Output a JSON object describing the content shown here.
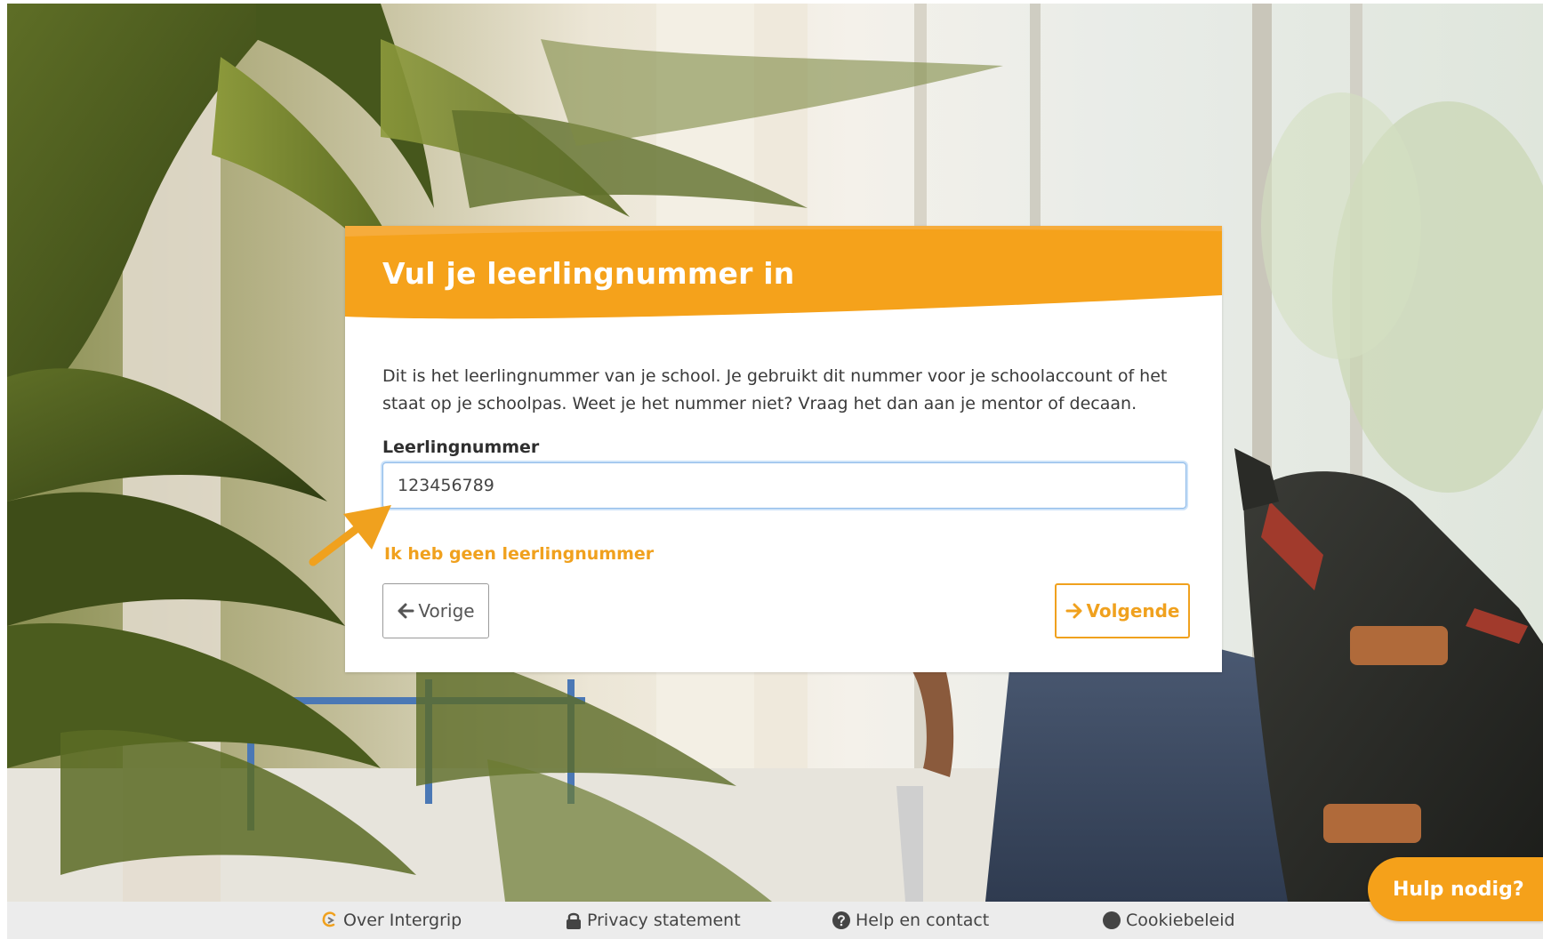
{
  "card": {
    "title": "Vul je leerlingnummer in",
    "description": "Dit is het leerlingnummer van je school. Je gebruikt dit nummer voor je schoolaccount of het staat op je schoolpas. Weet je het nummer niet? Vraag het dan aan je mentor of decaan.",
    "field_label": "Leerlingnummer",
    "field_value": "123456789",
    "no_number_link": "Ik heb geen leerlingnummer",
    "prev_button": "Vorige",
    "next_button": "Volgende"
  },
  "footer": {
    "items": [
      {
        "label": "Over Intergrip",
        "icon": "intergrip-logo-icon"
      },
      {
        "label": "Privacy statement",
        "icon": "lock-icon"
      },
      {
        "label": "Help en contact",
        "icon": "question-circle-icon"
      },
      {
        "label": "Cookiebeleid",
        "icon": "circle-icon"
      }
    ]
  },
  "help": {
    "label": "Hulp nodig?"
  },
  "colors": {
    "accent": "#f5a11a",
    "focus_border": "#8db9e8",
    "footer_bg": "#ececec"
  }
}
